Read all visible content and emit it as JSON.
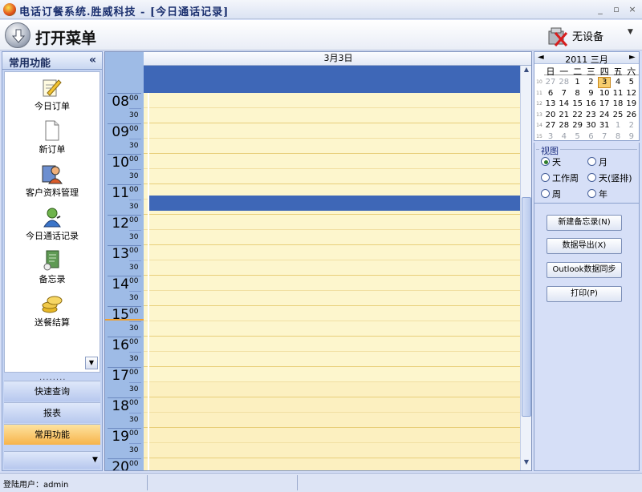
{
  "window": {
    "title": "电话订餐系统.胜威科技 - [今日通话记录]",
    "controls": [
      "_",
      "▫",
      "×"
    ]
  },
  "toolbar": {
    "open_menu_label": "打开菜单",
    "device_label": "无设备",
    "device_dropdown": "▼"
  },
  "left_panel": {
    "header": "常用功能",
    "collapse": "«",
    "items": [
      {
        "label": "今日订单",
        "icon": "order-edit-icon"
      },
      {
        "label": "新订单",
        "icon": "new-document-icon"
      },
      {
        "label": "客户资料管理",
        "icon": "customer-icon"
      },
      {
        "label": "今日通话记录",
        "icon": "call-record-icon"
      },
      {
        "label": "备忘录",
        "icon": "memo-icon"
      },
      {
        "label": "送餐结算",
        "icon": "coins-icon"
      }
    ],
    "grip": "........",
    "nav": [
      "快速查询",
      "报表",
      "常用功能"
    ],
    "active_nav": "常用功能",
    "scroll_down": "▼",
    "overflow": "▼"
  },
  "day_view": {
    "date_header": "3月3日",
    "hours": [
      "08",
      "09",
      "10",
      "11",
      "12",
      "13",
      "14",
      "15",
      "16",
      "17",
      "18",
      "19",
      "20"
    ],
    "minute_marks": [
      "00",
      "30"
    ],
    "selected_hour": "11",
    "scroll_up": "▲",
    "scroll_down": "▼"
  },
  "mini_calendar": {
    "month_label": "2011 三月",
    "prev": "◄",
    "next": "►",
    "weekdays": [
      "日",
      "一",
      "二",
      "三",
      "四",
      "五",
      "六"
    ],
    "week_numbers": [
      "10",
      "11",
      "12",
      "13",
      "14",
      "15"
    ],
    "rows": [
      [
        "27",
        "28",
        "1",
        "2",
        "3",
        "4",
        "5"
      ],
      [
        "6",
        "7",
        "8",
        "9",
        "10",
        "11",
        "12"
      ],
      [
        "13",
        "14",
        "15",
        "16",
        "17",
        "18",
        "19"
      ],
      [
        "20",
        "21",
        "22",
        "23",
        "24",
        "25",
        "26"
      ],
      [
        "27",
        "28",
        "29",
        "30",
        "31",
        "1",
        "2"
      ],
      [
        "3",
        "4",
        "5",
        "6",
        "7",
        "8",
        "9"
      ]
    ],
    "today": "3"
  },
  "view": {
    "legend": "视图",
    "options": [
      {
        "label": "天",
        "checked": true
      },
      {
        "label": "月",
        "checked": false
      },
      {
        "label": "工作周",
        "checked": false
      },
      {
        "label": "天(竖排)",
        "checked": false
      },
      {
        "label": "周",
        "checked": false
      },
      {
        "label": "年",
        "checked": false
      }
    ]
  },
  "actions": {
    "new_memo": "新建备忘录(N)",
    "export": "数据导出(X)",
    "outlook_sync": "Outlook数据同步",
    "print": "打印(P)"
  },
  "status": {
    "user": "登陆用户：admin"
  },
  "colors": {
    "selection": "#3e67b7",
    "work_hours": "#fdf6cd",
    "time_column": "#9ebbe6",
    "active_nav": "#f7b34a"
  }
}
